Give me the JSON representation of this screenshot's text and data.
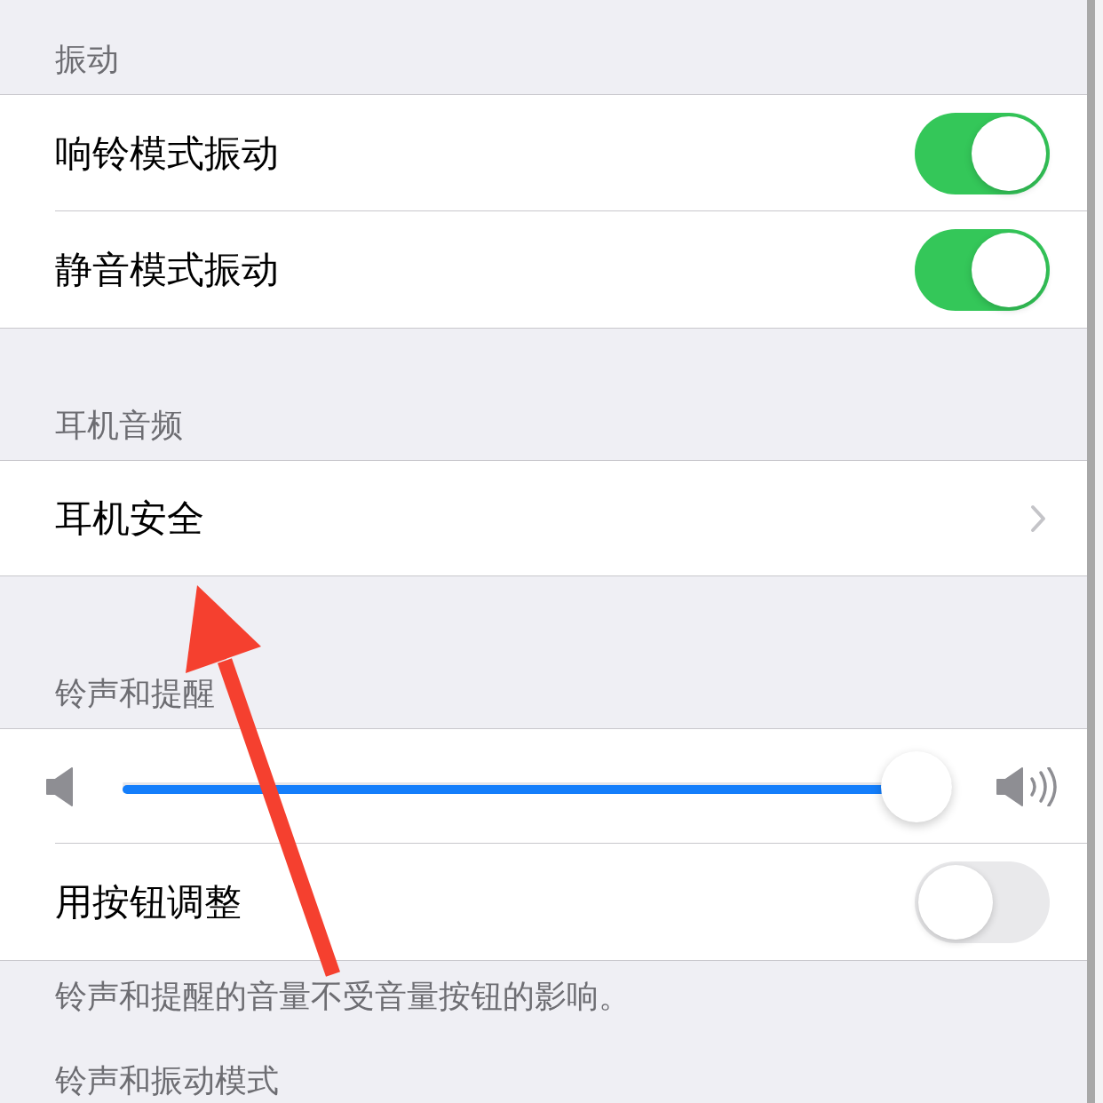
{
  "sections": [
    {
      "header": "振动",
      "rows": [
        {
          "kind": "toggle",
          "label": "响铃模式振动",
          "on": true
        },
        {
          "kind": "toggle",
          "label": "静音模式振动",
          "on": true
        }
      ]
    },
    {
      "header": "耳机音频",
      "rows": [
        {
          "kind": "link",
          "label": "耳机安全"
        }
      ]
    },
    {
      "header": "铃声和提醒",
      "rows": [
        {
          "kind": "slider",
          "level": 1
        },
        {
          "kind": "toggle",
          "label": "用按钮调整",
          "on": false
        }
      ],
      "footer": "铃声和提醒的音量不受音量按钮的影响。"
    },
    {
      "header": "铃声和振动模式"
    }
  ]
}
